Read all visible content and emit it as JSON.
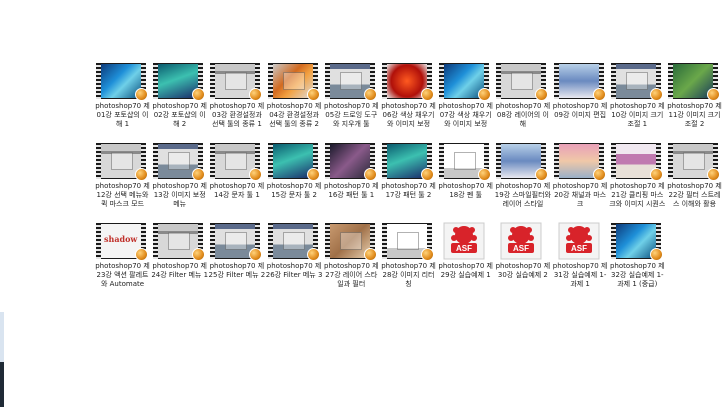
{
  "window": {
    "title": ""
  },
  "files": [
    {
      "label": "photoshop70 제01강 포토샵의 이해 1",
      "thumb": "i-blue",
      "type": "video"
    },
    {
      "label": "photoshop70 제02강 포토샵의 이해 2",
      "thumb": "i-teal",
      "type": "video"
    },
    {
      "label": "photoshop70 제03강 환경설정과 선택 툴의 종류 1",
      "thumb": "i-ui",
      "type": "video"
    },
    {
      "label": "photoshop70 제04강 환경설정과 선택 툴의 종류 2",
      "thumb": "i-orange",
      "type": "video"
    },
    {
      "label": "photoshop70 제05강 드로잉 도구와 지우개 툴",
      "thumb": "i-ui2",
      "type": "video"
    },
    {
      "label": "photoshop70 제06강 색상 채우기와 이미지 보정",
      "thumb": "i-red",
      "type": "video"
    },
    {
      "label": "photoshop70 제07강 색상 채우기와 이미지 보정",
      "thumb": "i-blue",
      "type": "video"
    },
    {
      "label": "photoshop70 제08강 레이어의 이해",
      "thumb": "i-ui",
      "type": "video"
    },
    {
      "label": "photoshop70 제09강 이미지 편집",
      "thumb": "i-sky",
      "type": "video"
    },
    {
      "label": "photoshop70 제10강 이미지 크기 조절 1",
      "thumb": "i-ui2",
      "type": "video"
    },
    {
      "label": "photoshop70 제11강 이미지 크기 조절 2",
      "thumb": "i-green",
      "type": "video"
    },
    {
      "label": "photoshop70 제12강 선택 메뉴와 퀵 마스크 모드",
      "thumb": "i-ui",
      "type": "video"
    },
    {
      "label": "photoshop70 제13강 이미지 보정 메뉴",
      "thumb": "i-ui2",
      "type": "video"
    },
    {
      "label": "photoshop70 제14강 문자 툴 1",
      "thumb": "i-ui",
      "type": "video"
    },
    {
      "label": "photoshop70 제15강 문자 툴 2",
      "thumb": "i-teal",
      "type": "video"
    },
    {
      "label": "photoshop70 제16강 패턴 툴 1",
      "thumb": "i-dark",
      "type": "video"
    },
    {
      "label": "photoshop70 제17강 패턴 툴 2",
      "thumb": "i-teal",
      "type": "video"
    },
    {
      "label": "photoshop70 제18강 펜 툴",
      "thumb": "i-white",
      "type": "video"
    },
    {
      "label": "photoshop70 제19강 스마일필터와 레이어 스타일",
      "thumb": "i-sky",
      "type": "video"
    },
    {
      "label": "photoshop70 제20강 채널과 마스크",
      "thumb": "i-sunset",
      "type": "video"
    },
    {
      "label": "photoshop70 제21강 클리핑 마스크와 이미지 시퀀스",
      "thumb": "i-pink",
      "type": "video"
    },
    {
      "label": "photoshop70 제22강 필터 스트레스 이해와 활용",
      "thumb": "i-ui",
      "type": "video"
    },
    {
      "label": "photoshop70 제23강 액션 팔레트와 Automate",
      "thumb": "i-shadow",
      "type": "video",
      "overlay_text": "shadow"
    },
    {
      "label": "photoshop70 제24강 Filter 메뉴 1",
      "thumb": "i-ui",
      "type": "video"
    },
    {
      "label": "photoshop70 제25강 Filter 메뉴 2",
      "thumb": "i-ui2",
      "type": "video"
    },
    {
      "label": "photoshop70 제26강 Filter 메뉴 3",
      "thumb": "i-ui2",
      "type": "video"
    },
    {
      "label": "photoshop70 제27강 레이어 스타일과 필터",
      "thumb": "i-brown",
      "type": "video"
    },
    {
      "label": "photoshop70 제28강 이미지 리터칭",
      "thumb": "i-white",
      "type": "video"
    },
    {
      "label": "photoshop70 제29강 실습예제 1",
      "thumb": "",
      "type": "asf"
    },
    {
      "label": "photoshop70 제30강 실습예제 2",
      "thumb": "",
      "type": "asf"
    },
    {
      "label": "photoshop70 제31강 실습예제 1-과제 1",
      "thumb": "",
      "type": "asf"
    },
    {
      "label": "photoshop70 제32강 실습예제 1-과제 1 (중급)",
      "thumb": "i-blue",
      "type": "video"
    }
  ],
  "asf_label": "ASF",
  "colors": {
    "badge": "#e08a1a",
    "asf_red": "#d8232a",
    "background": "#ffffff"
  }
}
